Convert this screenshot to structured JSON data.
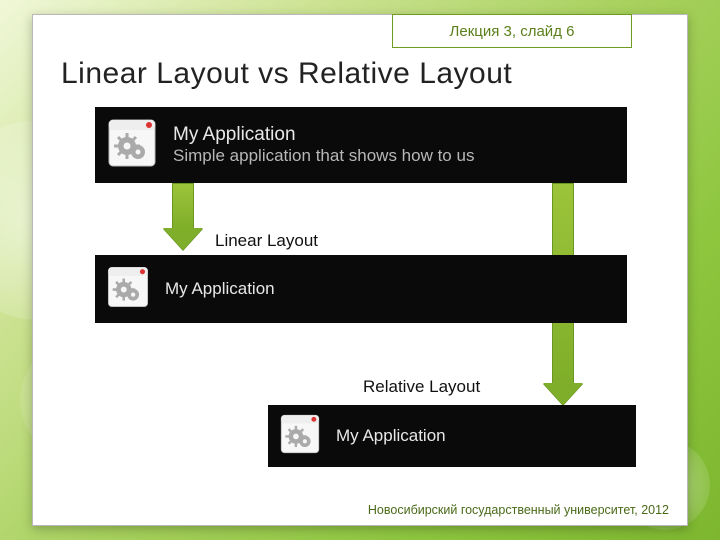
{
  "header": {
    "text": "Лекция 3, слайд 6"
  },
  "title": "Linear Layout vs Relative Layout",
  "panels": {
    "p1": {
      "title": "My Application",
      "subtitle": "Simple application that shows how to us"
    },
    "p2": {
      "title": "My Application"
    },
    "p3": {
      "title": "My Application"
    }
  },
  "captions": {
    "linear": "Linear Layout",
    "relative": "Relative Layout"
  },
  "footer": "Новосибирский государственный университет, 2012",
  "icons": {
    "app": "app-gear-icon"
  },
  "colors": {
    "accent": "#7fae2a",
    "border": "#6e9c1f"
  }
}
